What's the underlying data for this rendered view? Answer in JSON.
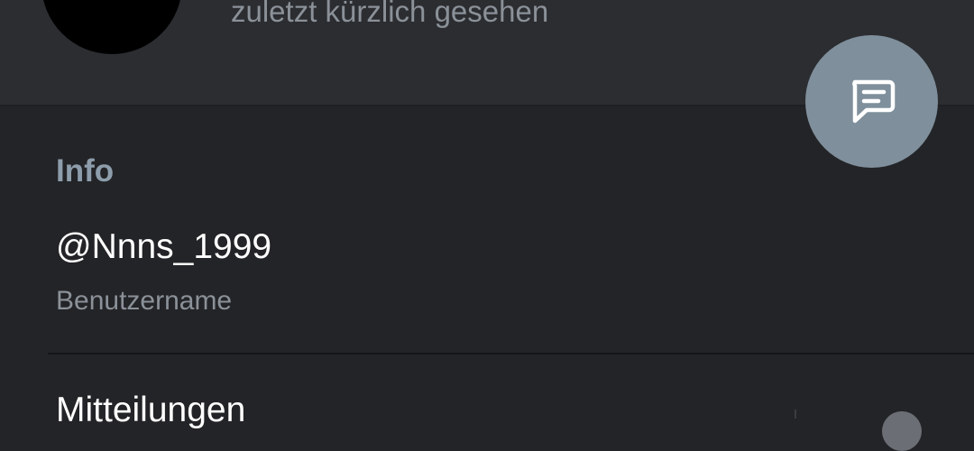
{
  "header": {
    "last_seen": "zuletzt kürzlich gesehen"
  },
  "fab": {
    "icon": "message-icon",
    "color": "#7f8f9b"
  },
  "info": {
    "section_title": "Info",
    "username": "@Nnns_1999",
    "username_label": "Benutzername"
  },
  "notifications": {
    "label": "Mitteilungen"
  },
  "colors": {
    "background": "#232427",
    "header_background": "#2b2d31",
    "accent": "#8d9dab"
  }
}
